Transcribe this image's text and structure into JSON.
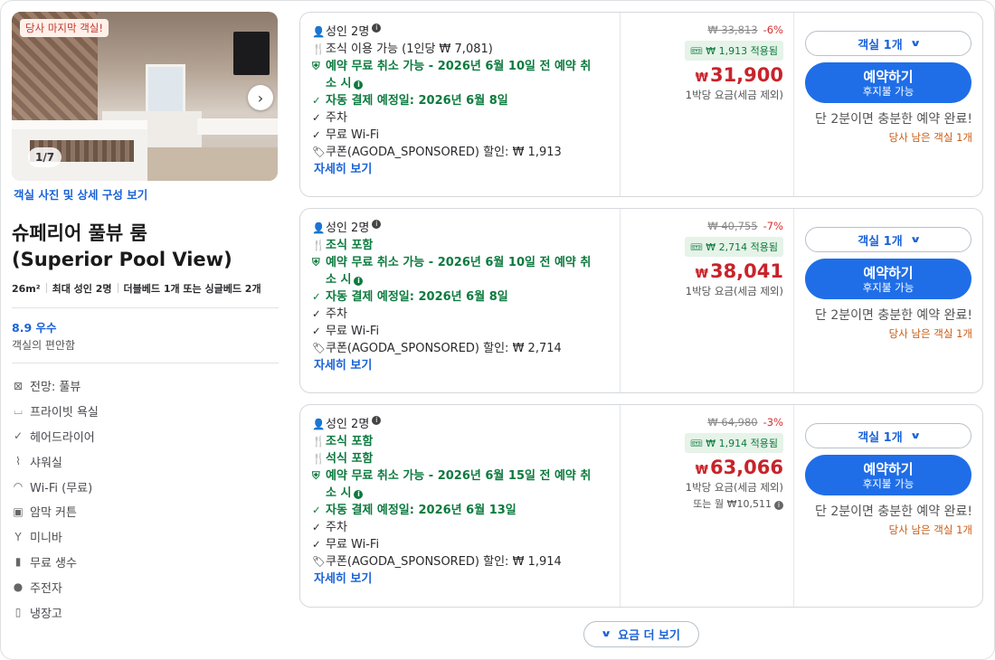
{
  "room": {
    "photo_badge": "당사 마지막 객실!",
    "photo_counter": "1/7",
    "photo_link": "객실 사진 및 상세 구성 보기",
    "title_ko": "슈페리어 풀뷰 룸",
    "title_en": "(Superior Pool View)",
    "size": "26m²",
    "max_guests": "최대 성인 2명",
    "beds": "더블베드 1개 또는 싱글베드 2개",
    "rating": "8.9 우수",
    "rating_sub": "객실의 편안함",
    "amenities": [
      {
        "icon": "view-icon",
        "label": "전망: 풀뷰"
      },
      {
        "icon": "bath-icon",
        "label": "프라이빗 욕실"
      },
      {
        "icon": "check-icon",
        "label": "헤어드라이어"
      },
      {
        "icon": "shower-icon",
        "label": "샤워실"
      },
      {
        "icon": "wifi-icon",
        "label": "Wi-Fi (무료)"
      },
      {
        "icon": "curtain-icon",
        "label": "암막 커튼"
      },
      {
        "icon": "minibar-icon",
        "label": "미니바"
      },
      {
        "icon": "water-icon",
        "label": "무료 생수"
      },
      {
        "icon": "parking-icon",
        "label": "주전자"
      },
      {
        "icon": "fridge-icon",
        "label": "냉장고"
      }
    ]
  },
  "offers": [
    {
      "guests": "성인 2명",
      "meal1": "조식 이용 가능 (1인당 ₩ 7,081)",
      "cancel_line1": "예약 무료 취소 가능 - 2026년 6월 10일 전 예약 취",
      "cancel_line2": "소 시",
      "autopay": "자동 결제 예정일: 2026년 6월 8일",
      "parking": "주차",
      "wifi": "무료 Wi-Fi",
      "coupon_line": "쿠폰(AGODA_SPONSORED) 할인: ₩ 1,913",
      "details": "자세히 보기",
      "old_price": "₩ 33,813",
      "discount_pct": "-6%",
      "coupon_badge": "₩ 1,913 적용됨",
      "currency": "₩",
      "price": "31,900",
      "price_note": "1박당 요금(세금 제외)",
      "room_select": "객실 1개",
      "book": "예약하기",
      "book_sub": "후지불 가능",
      "fast": "단 2분이면 충분한 예약 완료!",
      "last_room": "당사 남은 객실 1개"
    },
    {
      "guests": "성인 2명",
      "meal1": "조식 포함",
      "cancel_line1": "예약 무료 취소 가능 - 2026년 6월 10일 전 예약 취",
      "cancel_line2": "소 시",
      "autopay": "자동 결제 예정일: 2026년 6월 8일",
      "parking": "주차",
      "wifi": "무료 Wi-Fi",
      "coupon_line": "쿠폰(AGODA_SPONSORED) 할인: ₩ 2,714",
      "details": "자세히 보기",
      "old_price": "₩ 40,755",
      "discount_pct": "-7%",
      "coupon_badge": "₩ 2,714 적용됨",
      "currency": "₩",
      "price": "38,041",
      "price_note": "1박당 요금(세금 제외)",
      "room_select": "객실 1개",
      "book": "예약하기",
      "book_sub": "후지불 가능",
      "fast": "단 2분이면 충분한 예약 완료!",
      "last_room": "당사 남은 객실 1개"
    },
    {
      "guests": "성인 2명",
      "meal1": "조식 포함",
      "meal2": "석식 포함",
      "cancel_line1": "예약 무료 취소 가능 - 2026년 6월 15일 전 예약 취",
      "cancel_line2": "소 시",
      "autopay": "자동 결제 예정일: 2026년 6월 13일",
      "parking": "주차",
      "wifi": "무료 Wi-Fi",
      "coupon_line": "쿠폰(AGODA_SPONSORED) 할인: ₩ 1,914",
      "details": "자세히 보기",
      "old_price": "₩ 64,980",
      "discount_pct": "-3%",
      "coupon_badge": "₩ 1,914 적용됨",
      "currency": "₩",
      "price": "63,066",
      "price_note": "1박당 요금(세금 제외)",
      "monthly": "또는 월 ₩10,511",
      "room_select": "객실 1개",
      "book": "예약하기",
      "book_sub": "후지불 가능",
      "fast": "단 2분이면 충분한 예약 완료!",
      "last_room": "당사 남은 객실 1개"
    }
  ],
  "more_rates": "요금 더 보기",
  "colors": {
    "accent": "#1f6ee8",
    "price": "#c8232a",
    "green": "#0c7a3e",
    "warning": "#c75a13"
  }
}
